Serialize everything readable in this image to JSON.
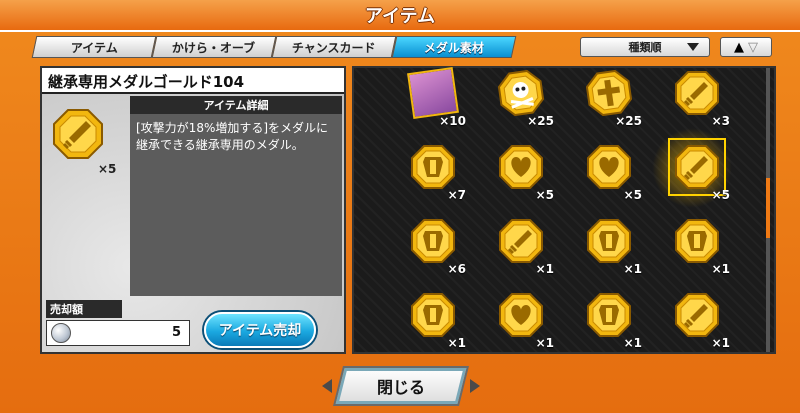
{
  "header": {
    "title": "アイテム"
  },
  "tabs": [
    {
      "label": "アイテム",
      "active": false
    },
    {
      "label": "かけら・オーブ",
      "active": false
    },
    {
      "label": "チャンスカード",
      "active": false
    },
    {
      "label": "メダル素材",
      "active": true
    }
  ],
  "sort": {
    "label": "種類順"
  },
  "selected_item": {
    "name": "継承専用メダルゴールド104",
    "detail_header": "アイテム詳細",
    "description": "[攻撃力が18%増加する]をメダルに継承できる継承専用のメダル。",
    "count": "×5",
    "icon": "sword-medal-icon"
  },
  "sell": {
    "label": "売却額",
    "value": "5",
    "button": "アイテム売却"
  },
  "grid": [
    {
      "icon": "character-portrait-icon",
      "count": "×10"
    },
    {
      "icon": "skull-crossbones-medal-icon",
      "count": "×25"
    },
    {
      "icon": "cross-medal-icon",
      "count": "×25"
    },
    {
      "icon": "sword-medal-icon",
      "count": "×3"
    },
    {
      "icon": "shield-medal-icon",
      "count": "×7"
    },
    {
      "icon": "heart-medal-icon",
      "count": "×5"
    },
    {
      "icon": "heart-medal-icon",
      "count": "×5"
    },
    {
      "icon": "sword-medal-icon",
      "count": "×5"
    },
    {
      "icon": "shield-medal-icon",
      "count": "×6"
    },
    {
      "icon": "sword-medal-icon",
      "count": "×1"
    },
    {
      "icon": "shield-medal-icon",
      "count": "×1"
    },
    {
      "icon": "shield-medal-icon",
      "count": "×1"
    },
    {
      "icon": "shield-medal-icon",
      "count": "×1"
    },
    {
      "icon": "heart-medal-icon",
      "count": "×1"
    },
    {
      "icon": "shield-medal-icon",
      "count": "×1"
    },
    {
      "icon": "sword-medal-icon",
      "count": "×1"
    }
  ],
  "selected_index": 7,
  "footer": {
    "close_label": "閉じる"
  },
  "colors": {
    "frame": "#f07a14",
    "accent": "#1aa8e0",
    "gold": "#f2b70f"
  }
}
